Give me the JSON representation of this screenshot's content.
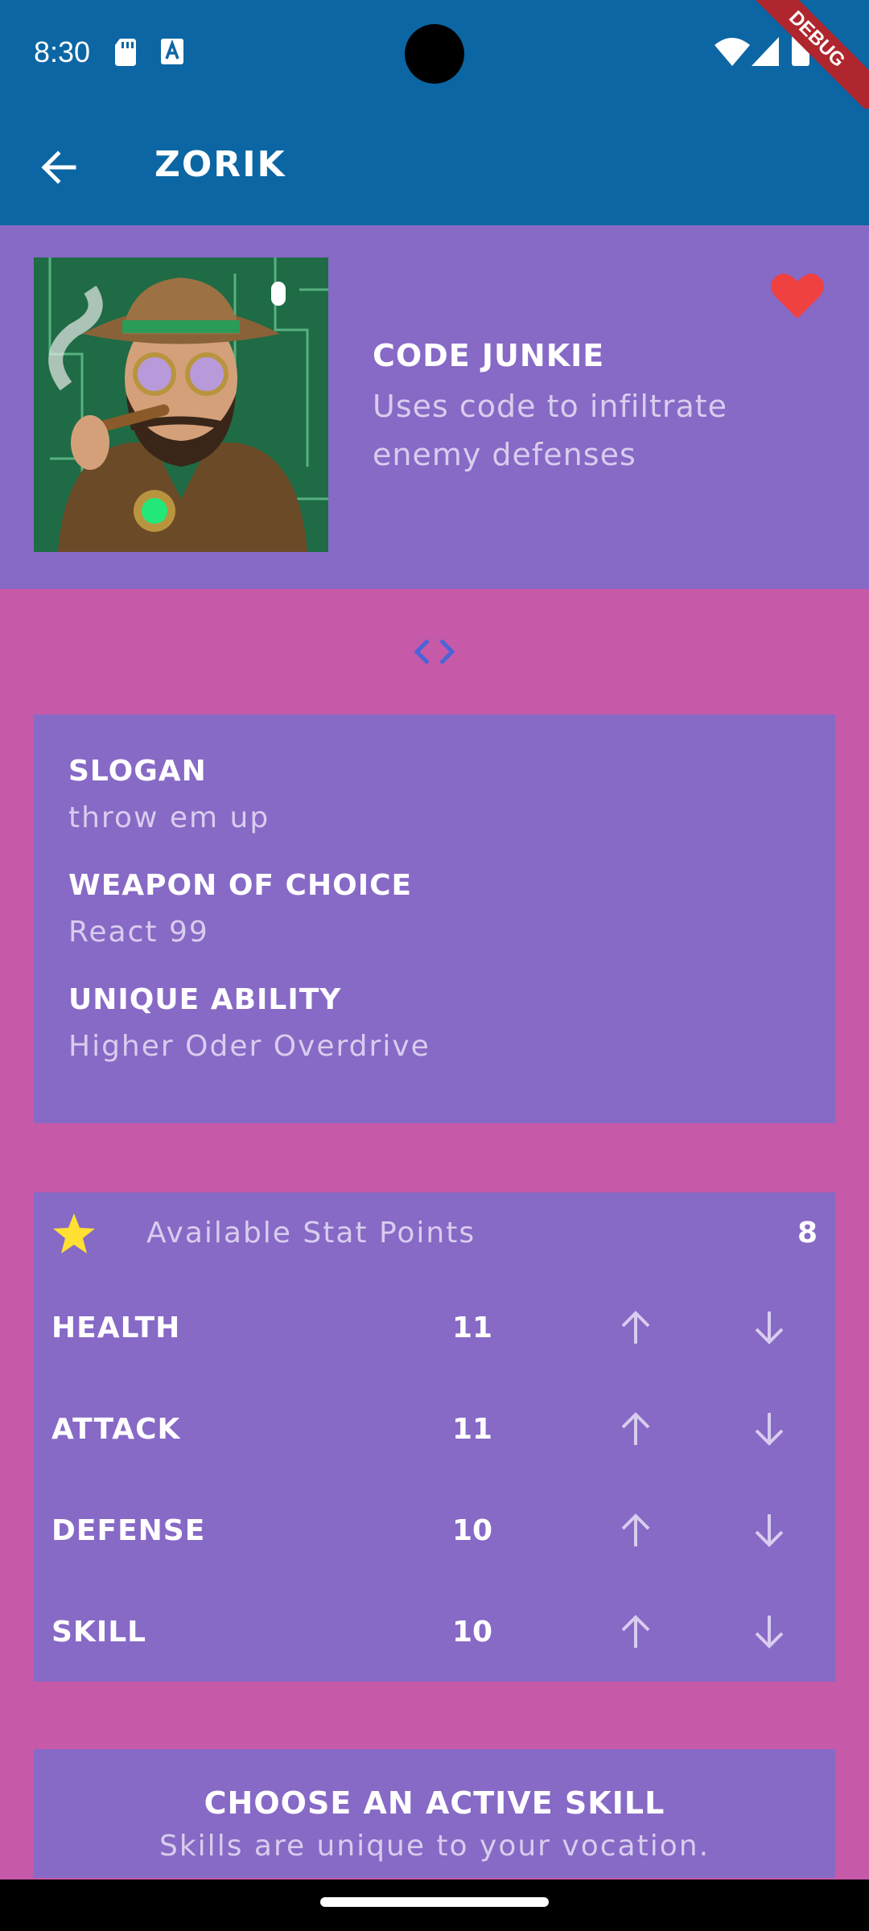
{
  "status_bar": {
    "time": "8:30",
    "debug_banner": "DEBUG"
  },
  "app_bar": {
    "title": "ZORIK"
  },
  "vocation": {
    "title": "CODE JUNKIE",
    "description": "Uses code to infiltrate enemy defenses",
    "favorite": true
  },
  "info": {
    "slogan_label": "SLOGAN",
    "slogan_value": "throw em up",
    "weapon_label": "WEAPON OF CHOICE",
    "weapon_value": "React 99",
    "ability_label": "UNIQUE ABILITY",
    "ability_value": "Higher Oder Overdrive"
  },
  "stats": {
    "available_label": "Available Stat Points",
    "available_value": "8",
    "rows": [
      {
        "name": "HEALTH",
        "value": "11"
      },
      {
        "name": "ATTACK",
        "value": "11"
      },
      {
        "name": "DEFENSE",
        "value": "10"
      },
      {
        "name": "SKILL",
        "value": "10"
      }
    ]
  },
  "skill_section": {
    "title": "CHOOSE AN ACTIVE SKILL",
    "subtitle": "Skills are unique to your vocation."
  },
  "colors": {
    "app_bar": "#0b66a3",
    "card": "#8769c6",
    "background": "#c659a8",
    "heart": "#f04141",
    "star": "#ffe033"
  }
}
